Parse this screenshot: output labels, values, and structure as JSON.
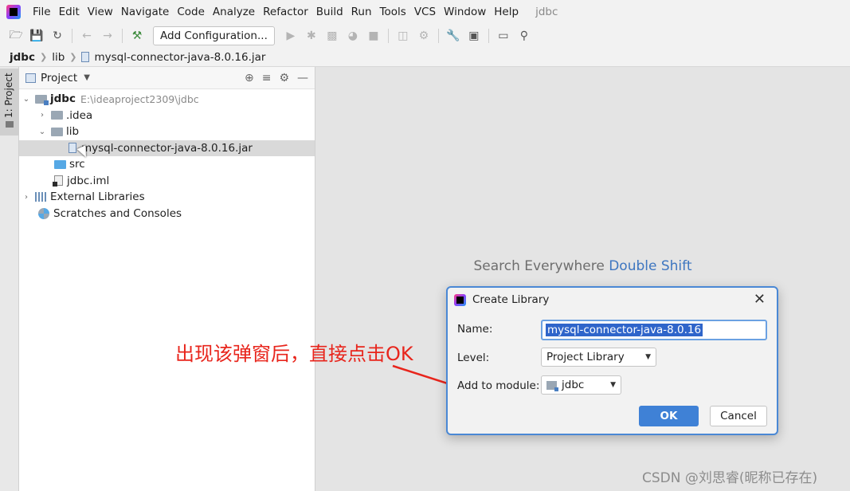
{
  "menubar": {
    "items": [
      "File",
      "Edit",
      "View",
      "Navigate",
      "Code",
      "Analyze",
      "Refactor",
      "Build",
      "Run",
      "Tools",
      "VCS",
      "Window",
      "Help"
    ],
    "project_name": "jdbc"
  },
  "toolbar": {
    "config_label": "Add Configuration..."
  },
  "breadcrumb": {
    "items": [
      "jdbc",
      "lib",
      "mysql-connector-java-8.0.16.jar"
    ]
  },
  "sidestrip": {
    "tab_label": "1: Project"
  },
  "project_panel": {
    "title": "Project",
    "tree": [
      {
        "label": "jdbc",
        "path": "E:\\ideaproject2309\\jdbc"
      },
      {
        "label": ".idea"
      },
      {
        "label": "lib"
      },
      {
        "label": "mysql-connector-java-8.0.16.jar"
      },
      {
        "label": "src"
      },
      {
        "label": "jdbc.iml"
      },
      {
        "label": "External Libraries"
      },
      {
        "label": "Scratches and Consoles"
      }
    ]
  },
  "editor": {
    "hint_text": "Search Everywhere",
    "hint_key": "Double Shift"
  },
  "dialog": {
    "title": "Create Library",
    "name_label": "Name:",
    "name_value": "mysql-connector-java-8.0.16",
    "level_label": "Level:",
    "level_value": "Project Library",
    "module_label": "Add to module:",
    "module_value": "jdbc",
    "ok_label": "OK",
    "cancel_label": "Cancel"
  },
  "annotation": {
    "text": "出现该弹窗后，直接点击OK",
    "color": "#e8251c"
  },
  "watermark": {
    "text": "CSDN @刘思睿(昵称已存在)"
  },
  "colors": {
    "accent": "#3f81d6",
    "selection": "#2f65ca"
  }
}
